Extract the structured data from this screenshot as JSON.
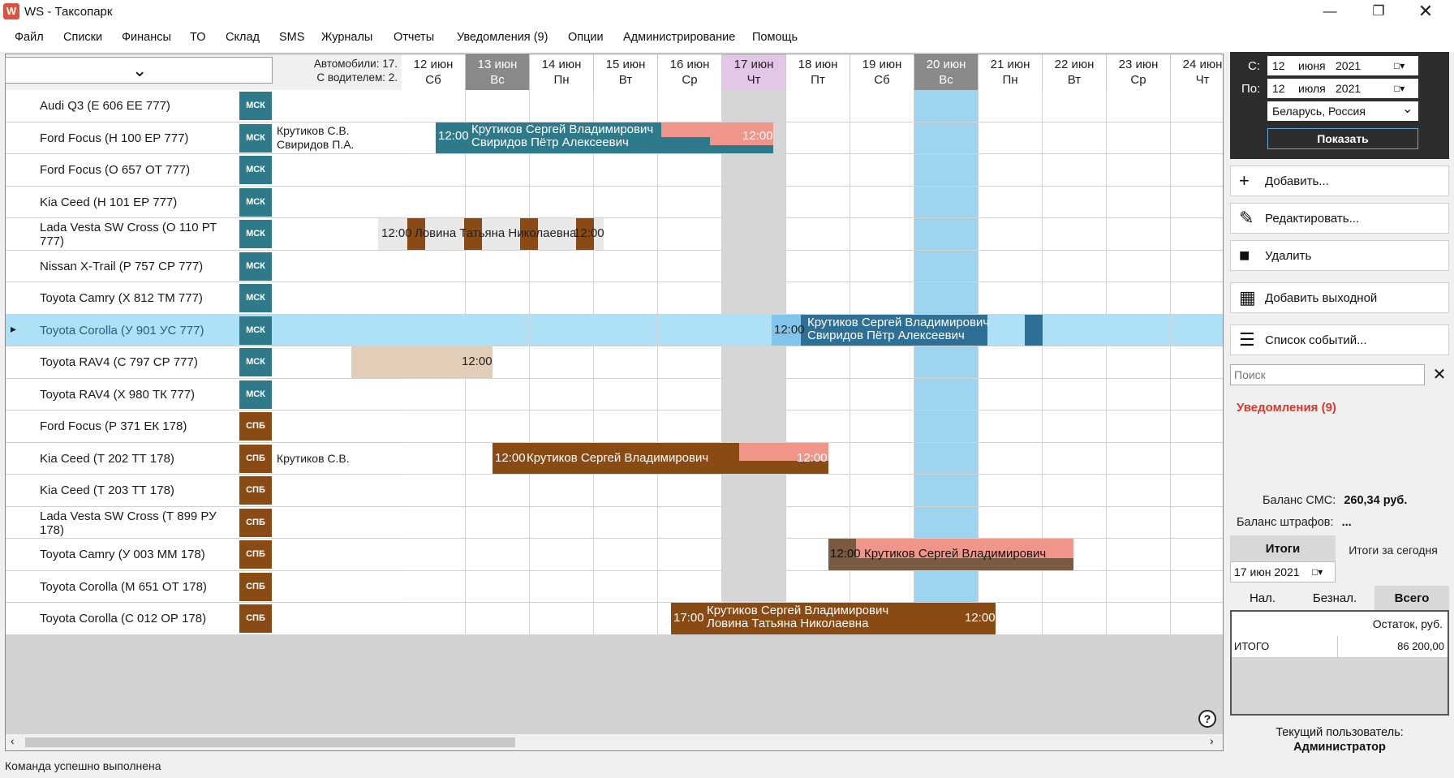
{
  "window": {
    "title": "WS - Таксопарк",
    "icon_letter": "W"
  },
  "menu": [
    "Файл",
    "Списки",
    "Финансы",
    "ТО",
    "Склад",
    "SMS",
    "Журналы",
    "Отчеты",
    "Уведомления (9)",
    "Опции",
    "Администрирование",
    "Помощь"
  ],
  "cars_info": {
    "line1": "Автомобили: 17.",
    "line2": "С водителем: 2."
  },
  "days": [
    {
      "date": "12 июн",
      "dow": "Сб",
      "style": ""
    },
    {
      "date": "13 июн",
      "dow": "Вс",
      "style": "gray"
    },
    {
      "date": "14 июн",
      "dow": "Пн",
      "style": ""
    },
    {
      "date": "15 июн",
      "dow": "Вт",
      "style": ""
    },
    {
      "date": "16 июн",
      "dow": "Ср",
      "style": ""
    },
    {
      "date": "17 июн",
      "dow": "Чт",
      "style": "lav"
    },
    {
      "date": "18 июн",
      "dow": "Пт",
      "style": ""
    },
    {
      "date": "19 июн",
      "dow": "Сб",
      "style": ""
    },
    {
      "date": "20 июн",
      "dow": "Вс",
      "style": "gray"
    },
    {
      "date": "21 июн",
      "dow": "Пн",
      "style": ""
    },
    {
      "date": "22 июн",
      "dow": "Вт",
      "style": ""
    },
    {
      "date": "23 июн",
      "dow": "Ср",
      "style": ""
    },
    {
      "date": "24 июн",
      "dow": "Чт",
      "style": ""
    }
  ],
  "cars": [
    {
      "name": "Audi Q3 (Е 606 ЕЕ 777)",
      "city": "МСК",
      "drivers": ""
    },
    {
      "name": "Ford Focus (Н 100 ЕР 777)",
      "city": "МСК",
      "drivers": "Крутиков С.В.\nСвиридов П.А."
    },
    {
      "name": "Ford Focus (О 657 ОТ 777)",
      "city": "МСК",
      "drivers": ""
    },
    {
      "name": "Kia Ceed (Н 101 ЕР 777)",
      "city": "МСК",
      "drivers": ""
    },
    {
      "name": "Lada Vesta SW Cross (О 110 РТ 777)",
      "city": "МСК",
      "drivers": ""
    },
    {
      "name": "Nissan X-Trail (Р 757 СР 777)",
      "city": "МСК",
      "drivers": ""
    },
    {
      "name": "Toyota Camry (Х 812 ТМ 777)",
      "city": "МСК",
      "drivers": ""
    },
    {
      "name": "Toyota Corolla (У 901 УС 777)",
      "city": "МСК",
      "drivers": "",
      "selected": true
    },
    {
      "name": "Toyota RAV4 (С 797 СР 777)",
      "city": "МСК",
      "drivers": ""
    },
    {
      "name": "Toyota RAV4 (Х 980 ТК 777)",
      "city": "МСК",
      "drivers": ""
    },
    {
      "name": "Ford Focus (Р 371 ЕК 178)",
      "city": "СПБ",
      "drivers": ""
    },
    {
      "name": "Kia Ceed (Т 202 ТТ 178)",
      "city": "СПБ",
      "drivers": "Крутиков С.В."
    },
    {
      "name": "Kia Ceed (Т 203 ТТ 178)",
      "city": "СПБ",
      "drivers": ""
    },
    {
      "name": "Lada Vesta SW Cross (Т 899 РУ 178)",
      "city": "СПБ",
      "drivers": ""
    },
    {
      "name": "Toyota Camry (У 003 ММ 178)",
      "city": "СПБ",
      "drivers": ""
    },
    {
      "name": "Toyota Corolla (М 651 ОТ 178)",
      "city": "СПБ",
      "drivers": ""
    },
    {
      "name": "Toyota Corolla (С 012 ОР 178)",
      "city": "СПБ",
      "drivers": ""
    }
  ],
  "colors": {
    "msk": "#2f7a8a",
    "spb": "#8a4a14",
    "teal": "#2f7a8a",
    "brown": "#8a4a14",
    "salmon": "#f0958a",
    "beige": "#e2cdb8",
    "selected_row": "#aee0f7",
    "sel_today_col": "#9fd4f0",
    "accent_red": "#d33a2c"
  },
  "bars": {
    "ford100_t1": "12:00",
    "ford100_n1": "Крутиков Сергей Владимирович",
    "ford100_n2": "Свиридов Пётр Алексеевич",
    "ford100_t2": "12:00",
    "lada_t1": "12:00",
    "lada_n": "Ловина Татьяна Николаевна",
    "lada_t2": "12:00",
    "corolla_t": "12:00",
    "corolla_n1": "Крутиков Сергей Владимирович",
    "corolla_n2": "Свиридов Пётр Алексеевич",
    "rav4_t": "12:00",
    "kia_t1": "12:00",
    "kia_n": "Крутиков Сергей Владимирович",
    "kia_t2": "12:00",
    "camry_t": "12:00",
    "camry_n": "Крутиков Сергей Владимирович",
    "c012_t1": "17:00",
    "c012_n1": "Крутиков Сергей Владимирович",
    "c012_n2": "Ловина Татьяна Николаевна",
    "c012_t2": "12:00"
  },
  "filter": {
    "from_label": "С:",
    "from_day": "12",
    "from_month": "июня",
    "from_year": "2021",
    "to_label": "По:",
    "to_day": "12",
    "to_month": "июля",
    "to_year": "2021",
    "region": "Беларусь, Россия",
    "show_button": "Показать"
  },
  "actions": {
    "add": "Добавить...",
    "edit": "Редактировать...",
    "delete": "Удалить",
    "add_dayoff": "Добавить выходной",
    "events": "Список событий..."
  },
  "search": {
    "placeholder": "Поиск"
  },
  "notifications": "Уведомления (9)",
  "balances": {
    "sms_label": "Баланс СМС:",
    "sms_value": "260,34 руб.",
    "fines_label": "Баланс штрафов:",
    "fines_value": "..."
  },
  "totals": {
    "tab": "Итоги",
    "today": "Итоги за сегодня",
    "date": "17 июн 2021",
    "cash": "Нал.",
    "noncash": "Безнал.",
    "all": "Всего",
    "col_header": "Остаток, руб.",
    "row_label": "ИТОГО",
    "row_value": "86 200,00"
  },
  "user": {
    "label": "Текущий пользователь:",
    "name": "Администратор"
  },
  "status": "Команда успешно выполнена"
}
